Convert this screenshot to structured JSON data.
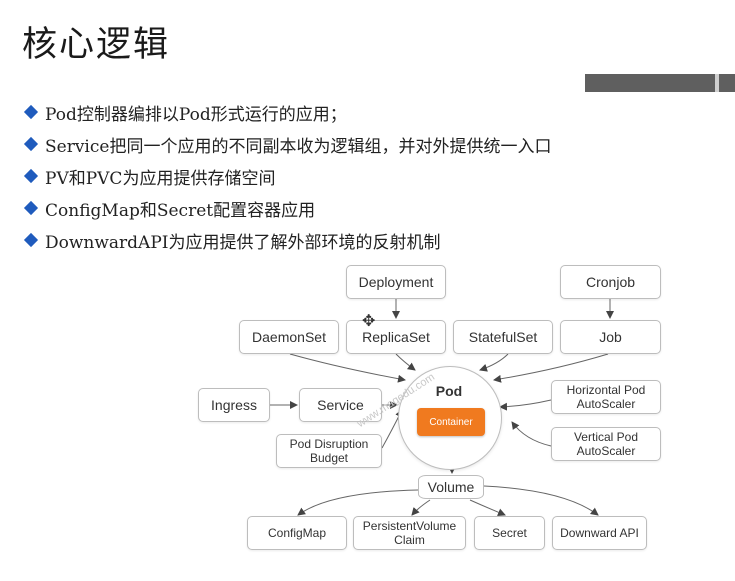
{
  "slide": {
    "title": "核心逻辑",
    "bullets": [
      "Pod控制器编排以Pod形式运行的应用；",
      "Service把同一个应用的不同副本收为逻辑组，并对外提供统一入口",
      "PV和PVC为应用提供存储空间",
      "ConfigMap和Secret配置容器应用",
      "DownwardAPI为应用提供了解外部环境的反射机制"
    ]
  },
  "diagram": {
    "deployment": "Deployment",
    "cronjob": "Cronjob",
    "daemonset": "DaemonSet",
    "replicaset": "ReplicaSet",
    "statefulset": "StatefulSet",
    "job": "Job",
    "ingress": "Ingress",
    "service": "Service",
    "pdb": "Pod Disruption Budget",
    "pod": "Pod",
    "container": "Container",
    "hpa": "Horizontal Pod AutoScaler",
    "vpa": "Vertical Pod AutoScaler",
    "volume": "Volume",
    "configmap": "ConfigMap",
    "pvc": "PersistentVolume Claim",
    "secret": "Secret",
    "downward": "Downward API",
    "watermark": "www.magedu.com"
  },
  "colors": {
    "bullet": "#1f5bbd",
    "container": "#f07a1f",
    "bar": "#5f5f5f"
  },
  "icons": [
    "diamond-bullet-icon",
    "move-cursor-icon"
  ]
}
